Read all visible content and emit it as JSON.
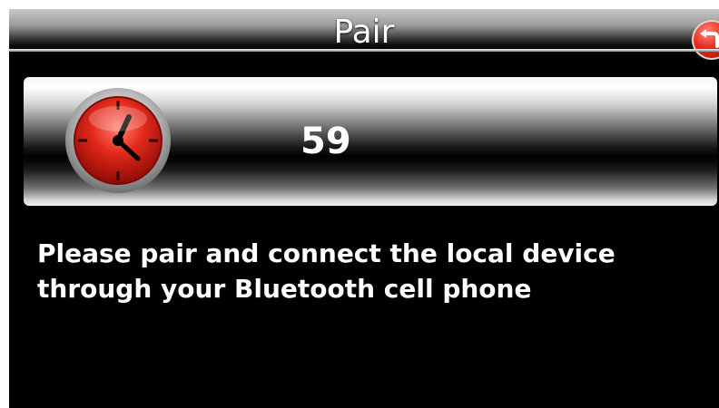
{
  "header": {
    "title": "Pair",
    "back_icon": "back-arrow-icon"
  },
  "timer": {
    "icon": "clock-icon",
    "seconds_remaining": "59"
  },
  "message": {
    "line1": "Please pair and connect the local device",
    "line2": "through your Bluetooth cell phone"
  },
  "colors": {
    "background": "#000000",
    "accent_red": "#d81e12",
    "text": "#ffffff"
  }
}
